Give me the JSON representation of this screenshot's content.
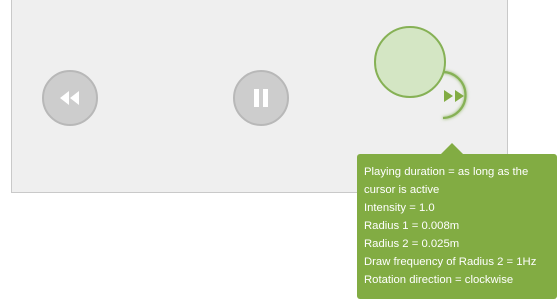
{
  "player": {
    "rewind_icon": "rewind-icon",
    "pause_icon": "pause-icon",
    "fast_forward_icon": "fast-forward-icon",
    "accent_color": "#82ac43",
    "button_color": "#cdcdcd"
  },
  "tooltip": {
    "lines": [
      "Playing duration = as long as the",
      "cursor is active",
      "Intensity = 1.0",
      "Radius 1 = 0.008m",
      "Radius 2 = 0.025m",
      "Draw frequency of Radius 2 = 1Hz",
      "Rotation direction = clockwise"
    ]
  }
}
